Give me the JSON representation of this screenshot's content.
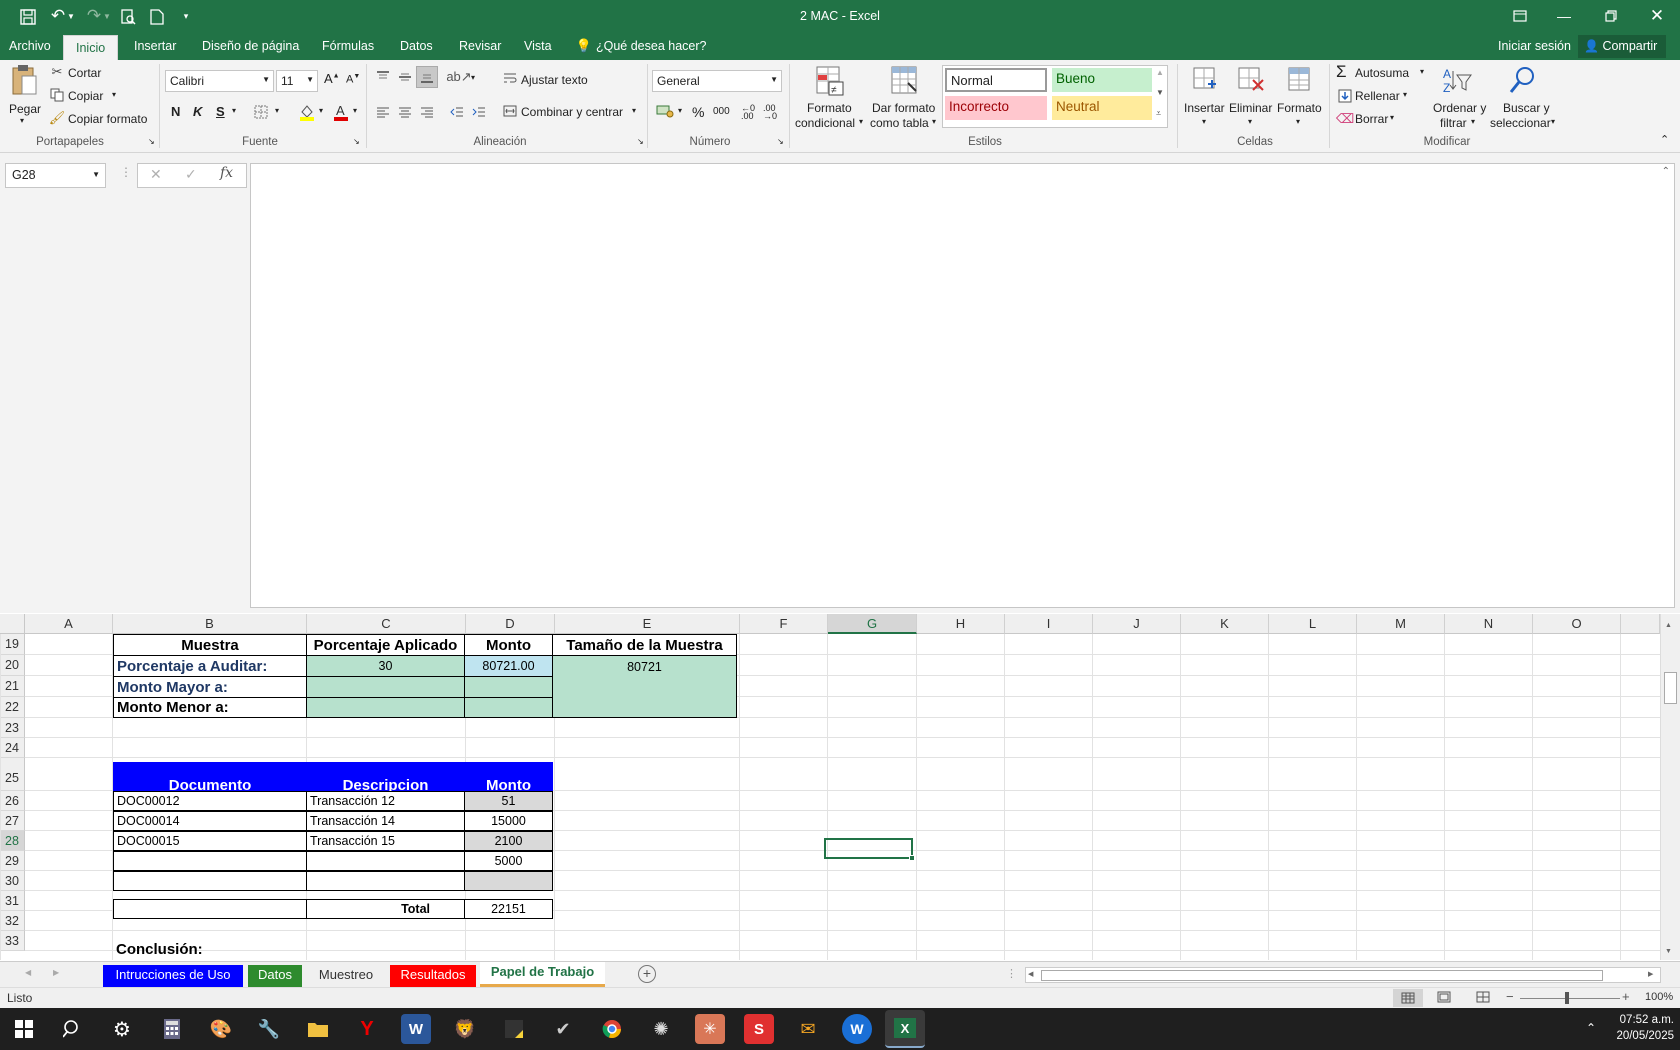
{
  "window": {
    "title": "2 MAC - Excel"
  },
  "ribbon_tabs": [
    "Archivo",
    "Inicio",
    "Insertar",
    "Diseño de página",
    "Fórmulas",
    "Datos",
    "Revisar",
    "Vista"
  ],
  "tell_me": "¿Qué desea hacer?",
  "account": {
    "signin": "Iniciar sesión",
    "share": "Compartir"
  },
  "clipboard": {
    "paste": "Pegar",
    "cut": "Cortar",
    "copy": "Copiar",
    "format_painter": "Copiar formato",
    "label": "Portapapeles"
  },
  "font": {
    "name": "Calibri",
    "size": "11",
    "bold": "N",
    "italic": "K",
    "underline": "S",
    "label": "Fuente"
  },
  "alignment": {
    "wrap": "Ajustar texto",
    "merge": "Combinar y centrar",
    "label": "Alineación"
  },
  "number": {
    "format": "General",
    "percent": "%",
    "thousands": "000",
    "label": "Número"
  },
  "styles": {
    "cond_format_1": "Formato",
    "cond_format_2": "condicional",
    "table_format_1": "Dar formato",
    "table_format_2": "como tabla",
    "normal": "Normal",
    "good": "Bueno",
    "bad": "Incorrecto",
    "neutral": "Neutral",
    "label": "Estilos"
  },
  "cells": {
    "insert": "Insertar",
    "delete": "Eliminar",
    "format": "Formato",
    "label": "Celdas"
  },
  "editing": {
    "autosum": "Autosuma",
    "fill": "Rellenar",
    "clear": "Borrar",
    "sort_1": "Ordenar y",
    "sort_2": "filtrar",
    "find_1": "Buscar y",
    "find_2": "seleccionar",
    "label": "Modificar"
  },
  "formula_bar": {
    "name_box": "G28",
    "fx": "fx",
    "content": ""
  },
  "columns": [
    "A",
    "B",
    "C",
    "D",
    "E",
    "F",
    "G",
    "H",
    "I",
    "J",
    "K",
    "L",
    "M",
    "N",
    "O"
  ],
  "rows": [
    "19",
    "20",
    "21",
    "22",
    "23",
    "24",
    "25",
    "26",
    "27",
    "28",
    "29",
    "30",
    "31",
    "32",
    "33"
  ],
  "sheet": {
    "muestra_h": "Muestra",
    "porc_aplicado_h": "Porcentaje Aplicado",
    "monto_h": "Monto",
    "tamano_h": "Tamaño de la Muestra",
    "porc_auditar": "Porcentaje a Auditar:",
    "porc_val": "30",
    "monto_val": "80721.00",
    "tamano_val": "80721",
    "mayor": "Monto Mayor a:",
    "menor": "Monto Menor a:",
    "doc_h": "Documento",
    "desc_h": "Descripcion",
    "monto2_h": "Monto",
    "docs": [
      {
        "doc": "DOC00012",
        "desc": "Transacción 12",
        "monto": "51"
      },
      {
        "doc": "DOC00014",
        "desc": "Transacción 14",
        "monto": "15000"
      },
      {
        "doc": "DOC00015",
        "desc": "Transacción 15",
        "monto": "2100"
      },
      {
        "doc": "",
        "desc": "",
        "monto": "5000"
      },
      {
        "doc": "",
        "desc": "",
        "monto": ""
      }
    ],
    "total_label": "Total",
    "total_val": "22151",
    "conclusion": "Conclusión:"
  },
  "sheet_tabs": [
    "Intrucciones de Uso",
    "Datos",
    "Muestreo",
    "Resultados",
    "Papel de Trabajo"
  ],
  "status": {
    "ready": "Listo",
    "zoom": "100%"
  },
  "clock": {
    "time": "07:52 a.m.",
    "date": "20/05/2025"
  },
  "colors": {
    "excel_green": "#217346",
    "good_fill": "#c6efce",
    "bad_fill": "#ffc7ce",
    "neutral_fill": "#ffeb9c",
    "header_blue": "#0000ff",
    "green_fill": "#b7e1cd"
  }
}
